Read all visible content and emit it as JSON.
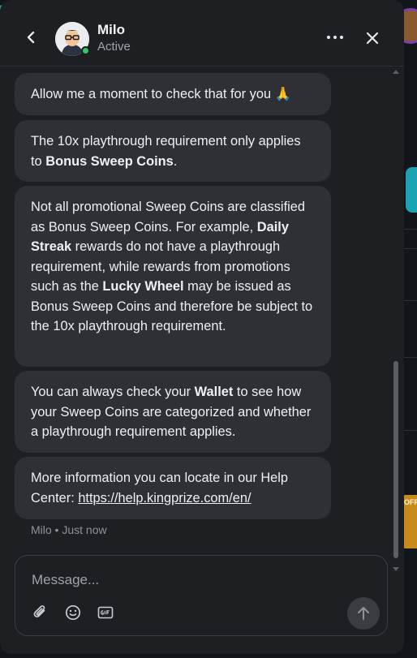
{
  "header": {
    "agent_name": "Milo",
    "agent_status": "Active"
  },
  "messages": [
    {
      "parts": [
        "Allow me a moment to check that for you 🙏"
      ]
    },
    {
      "parts": [
        "The 10x playthrough requirement only applies to ",
        "Bonus Sweep Coins",
        "."
      ]
    },
    {
      "parts": [
        "Not all promotional Sweep Coins are classified as Bonus Sweep Coins. For example, ",
        "Daily Streak",
        " rewards do not have a playthrough requirement, while rewards from promotions such as the ",
        "Lucky Wheel",
        " may be issued as Bonus Sweep Coins and therefore be subject to the 10x playthrough requirement."
      ]
    },
    {
      "parts": [
        "You can always check your ",
        "Wallet",
        " to see how your Sweep Coins are categorized and whether a playthrough requirement applies."
      ]
    },
    {
      "parts": [
        "More information you can locate in our Help Center: ",
        "https://help.kingprize.com/en/"
      ]
    }
  ],
  "meta": "Milo • Just now",
  "composer": {
    "placeholder": "Message..."
  },
  "background": {
    "side_label": "OFF"
  },
  "icons": {
    "back": "chevron-left-icon",
    "more": "more-horizontal-icon",
    "close": "close-icon",
    "attach": "paperclip-icon",
    "emoji": "smiley-icon",
    "gif": "gif-icon",
    "send": "arrow-up-icon"
  },
  "colors": {
    "panel": "#1d1f23",
    "bubble": "#2e3035",
    "status_online": "#35c76a"
  }
}
